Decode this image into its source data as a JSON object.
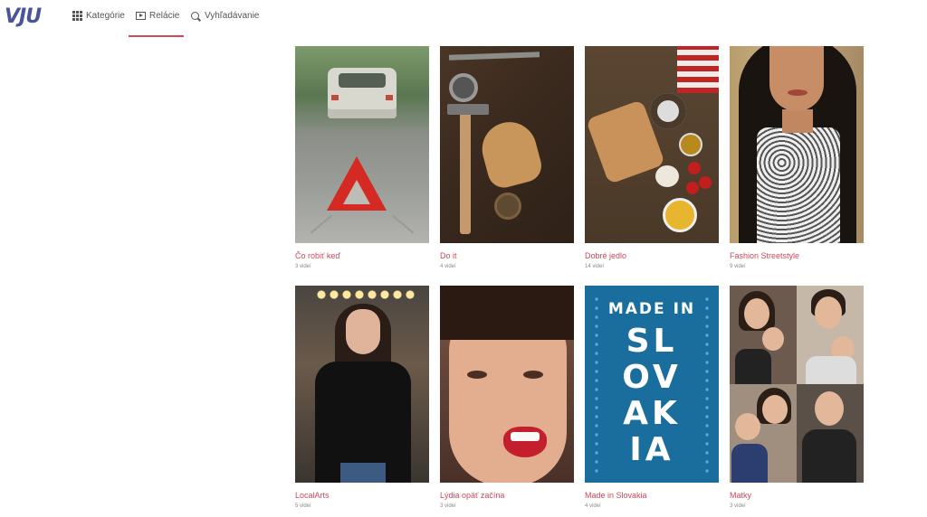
{
  "header": {
    "logo": "VJU",
    "nav": [
      {
        "label": "Kategórie",
        "icon": "grid-icon"
      },
      {
        "label": "Relácie",
        "icon": "play-icon",
        "active": true
      },
      {
        "label": "Vyhľadávanie",
        "icon": "search-icon"
      }
    ],
    "accent_color": "#d0485a"
  },
  "shows": [
    {
      "title": "Čo robiť keď",
      "count": "3 videí"
    },
    {
      "title": "Do it",
      "count": "4 videí"
    },
    {
      "title": "Dobré jedlo",
      "count": "14 videí"
    },
    {
      "title": "Fashion Streetstyle",
      "count": "9 videí"
    },
    {
      "title": "LocalArts",
      "count": "5 videí"
    },
    {
      "title": "Lýdia opäť začína",
      "count": "3 videí"
    },
    {
      "title": "Made in Slovakia",
      "count": "4 videí"
    },
    {
      "title": "Matky",
      "count": "3 videí"
    }
  ],
  "poster": {
    "made_in": "MADE IN",
    "lines": [
      "SL",
      "OV",
      "AK",
      "IA"
    ]
  }
}
